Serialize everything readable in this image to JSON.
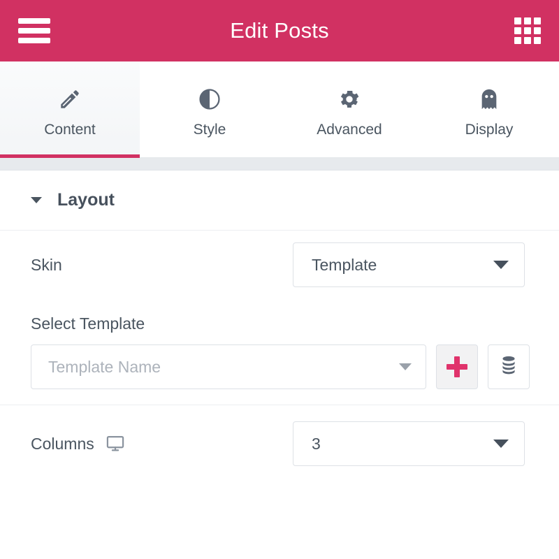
{
  "header": {
    "title": "Edit Posts",
    "menu_icon": "hamburger-menu-icon",
    "apps_icon": "grid-apps-icon",
    "background_color": "#d13162"
  },
  "tabs": [
    {
      "label": "Content",
      "icon": "pencil-icon",
      "active": true
    },
    {
      "label": "Style",
      "icon": "contrast-icon",
      "active": false
    },
    {
      "label": "Advanced",
      "icon": "gear-icon",
      "active": false
    },
    {
      "label": "Display",
      "icon": "ghost-icon",
      "active": false
    }
  ],
  "section": {
    "title": "Layout",
    "expanded": true,
    "caret_icon": "caret-down-icon"
  },
  "fields": {
    "skin": {
      "label": "Skin",
      "value": "Template",
      "arrow_icon": "chevron-down-icon"
    },
    "select_template": {
      "label": "Select Template",
      "placeholder": "Template Name",
      "arrow_icon": "chevron-down-icon",
      "add_button": {
        "icon": "plus-icon",
        "color": "#e0336b"
      },
      "library_button": {
        "icon": "database-stack-icon"
      }
    },
    "columns": {
      "label": "Columns",
      "device_icon": "desktop-monitor-icon",
      "value": "3",
      "arrow_icon": "chevron-down-icon"
    }
  },
  "accent_color": "#d13162",
  "text_color": "#4a5560"
}
